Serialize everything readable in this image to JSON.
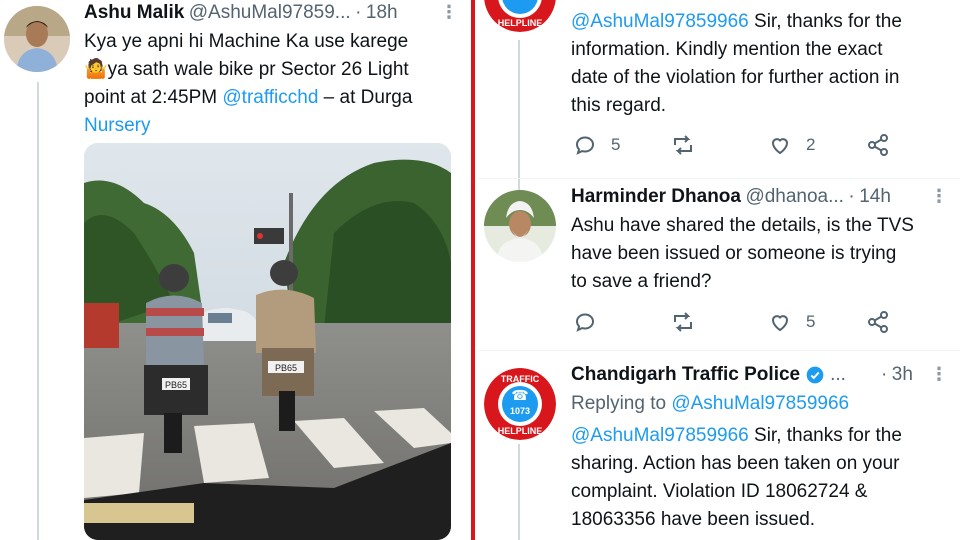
{
  "left_tweet": {
    "name": "Ashu Malik",
    "handle": "@AshuMal97859...",
    "separator": "·",
    "time": "18h",
    "text_line1": "Kya ye apni hi Machine Ka use karege",
    "text_line2_emoji": "🤷",
    "text_line2": "ya sath wale bike pr Sector 26 Light",
    "text_line3_pre": "point at 2:45PM ",
    "mention": "@trafficchd",
    "text_line3_post": " – at Durga",
    "location_line": "Nursery",
    "photo_icon": "street-photo",
    "plate_left": "PB65",
    "plate_right": "PB65"
  },
  "right_tweet_top": {
    "mention": "@AshuMal97859966",
    "text_line1_post": " Sir, thanks for the",
    "text_line2": "information. Kindly mention the exact",
    "text_line3": "date of the violation for further action in",
    "text_line4": "this regard.",
    "reply_count": "5",
    "retweet_count": "",
    "like_count": "2"
  },
  "right_tweet_mid": {
    "name": "Harminder Dhanoa",
    "handle": "@dhanoa...",
    "separator": "·",
    "time": "14h",
    "text_line1": "Ashu have shared the details, is the TVS",
    "text_line2": "have been issued or someone is trying",
    "text_line3": "to save a friend?",
    "reply_count": "",
    "retweet_count": "",
    "like_count": "5"
  },
  "right_tweet_bottom": {
    "name": "Chandigarh Traffic Police",
    "verified_icon": "verified-badge-icon",
    "ellipsis": "...",
    "separator": "·",
    "time": "3h",
    "replying_prefix": "Replying to ",
    "replying_to": "@AshuMal97859966",
    "mention": "@AshuMal97859966",
    "text_line1_post": " Sir, thanks for the",
    "text_line2": "sharing. Action has been taken on your",
    "text_line3": "complaint. Violation ID 18062724 &",
    "text_line4": "18063356 have been issued."
  },
  "logo": {
    "top_text": "TRAFFIC",
    "number": "1073",
    "bottom_text": "HELPLINE",
    "color": "#d8171c"
  },
  "colors": {
    "link": "#1d9bf0",
    "divider": "#d8171c",
    "muted": "#536471"
  }
}
